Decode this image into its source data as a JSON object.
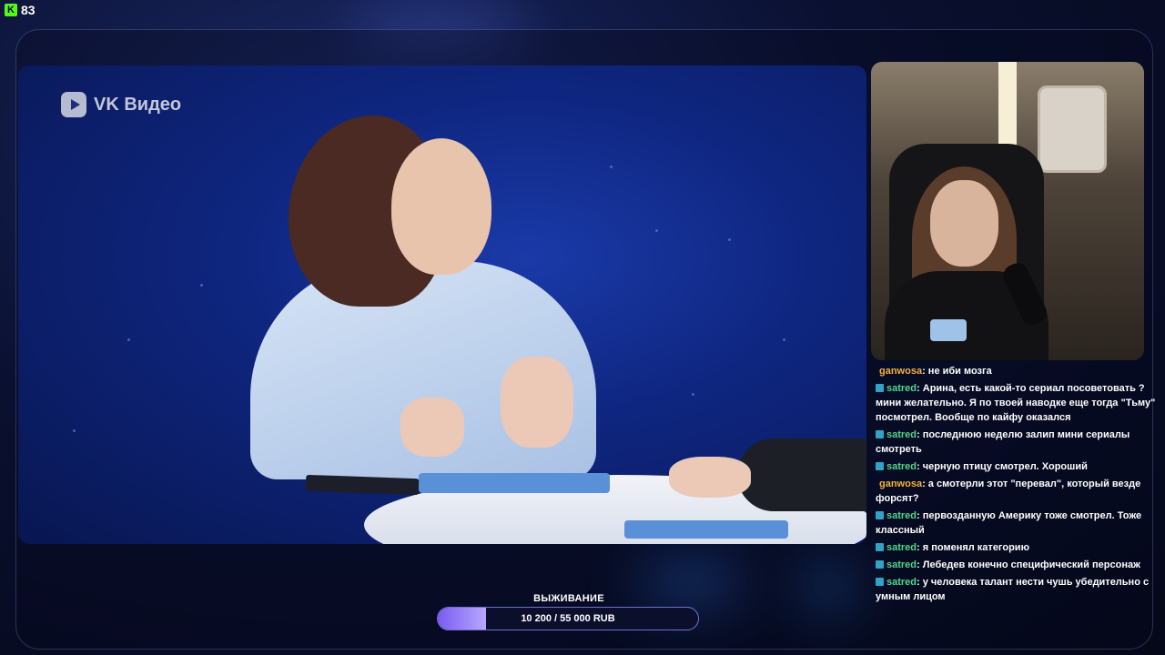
{
  "viewer": {
    "icon": "kick-logo-icon",
    "icon_glyph": "K",
    "count": "83"
  },
  "stream": {
    "watermark": "VK Видео"
  },
  "chat": {
    "messages": [
      {
        "user": "ganwosa",
        "color": "#f3b33d",
        "badge": false,
        "text": ": не иби мозга"
      },
      {
        "user": "satred",
        "color": "#4dd88c",
        "badge": true,
        "text": ": Арина, есть какой-то сериал посоветовать ? мини желательно. Я по твоей наводке еще тогда \"Тьму\" посмотрел. Вообще по кайфу оказался"
      },
      {
        "user": "satred",
        "color": "#4dd88c",
        "badge": true,
        "text": ": последнюю неделю залип мини сериалы смотреть"
      },
      {
        "user": "satred",
        "color": "#4dd88c",
        "badge": true,
        "text": ": черную птицу смотрел. Хороший"
      },
      {
        "user": "ganwosa",
        "color": "#f3b33d",
        "badge": false,
        "text": ": а смотерли этот \"перевал\", который везде форсят?"
      },
      {
        "user": "satred",
        "color": "#4dd88c",
        "badge": true,
        "text": ": первозданную Америку тоже смотрел. Тоже классный"
      },
      {
        "user": "satred",
        "color": "#4dd88c",
        "badge": true,
        "text": ": я поменял категорию"
      },
      {
        "user": "satred",
        "color": "#4dd88c",
        "badge": true,
        "text": ": Лебедев конечно специфический персонаж"
      },
      {
        "user": "satred",
        "color": "#4dd88c",
        "badge": true,
        "text": ": у человека талант нести чушь убедительно с умным лицом"
      }
    ]
  },
  "goal": {
    "title": "ВЫЖИВАНИЕ",
    "progress_text": "10 200 / 55 000 RUB",
    "progress_fraction": 0.185
  }
}
